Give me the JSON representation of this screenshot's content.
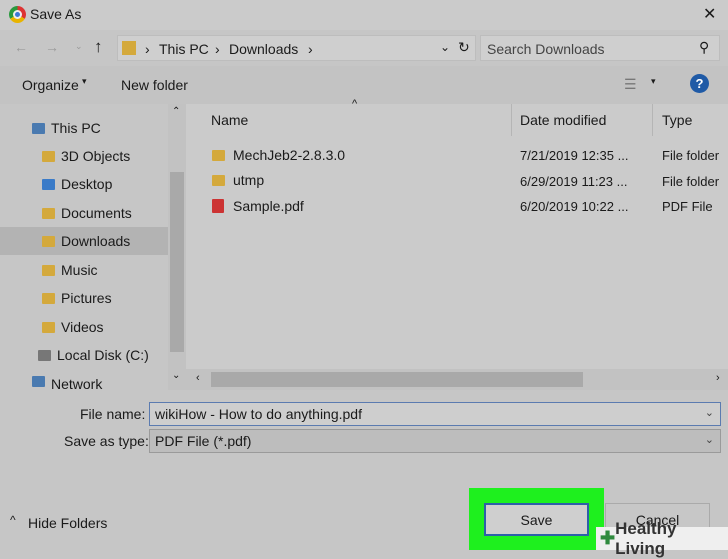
{
  "window": {
    "title": "Save As",
    "close": "✕"
  },
  "address": {
    "crumbs": [
      "This PC",
      "Downloads"
    ],
    "sep": "›"
  },
  "search": {
    "placeholder": "Search Downloads"
  },
  "toolbar": {
    "organize": "Organize",
    "new_folder": "New folder",
    "help": "?"
  },
  "nav": {
    "items": [
      "This PC",
      "3D Objects",
      "Desktop",
      "Documents",
      "Downloads",
      "Music",
      "Pictures",
      "Videos",
      "Local Disk (C:)",
      "Network"
    ]
  },
  "columns": [
    "Name",
    "Date modified",
    "Type"
  ],
  "files": [
    {
      "name": "MechJeb2-2.8.3.0",
      "date": "7/21/2019 12:35 ...",
      "type": "File folder",
      "icon": "folder"
    },
    {
      "name": "utmp",
      "date": "6/29/2019 11:23 ...",
      "type": "File folder",
      "icon": "folder"
    },
    {
      "name": "Sample.pdf",
      "date": "6/20/2019 10:22 ...",
      "type": "PDF File",
      "icon": "pdf"
    }
  ],
  "form": {
    "file_name_label": "File name:",
    "file_name": "wikiHow - How to do anything.pdf",
    "type_label": "Save as type:",
    "type_value": "PDF File (*.pdf)"
  },
  "footer": {
    "hide_folders": "Hide Folders",
    "save": "Save",
    "cancel": "Cancel"
  },
  "watermark": "Healthy Living"
}
